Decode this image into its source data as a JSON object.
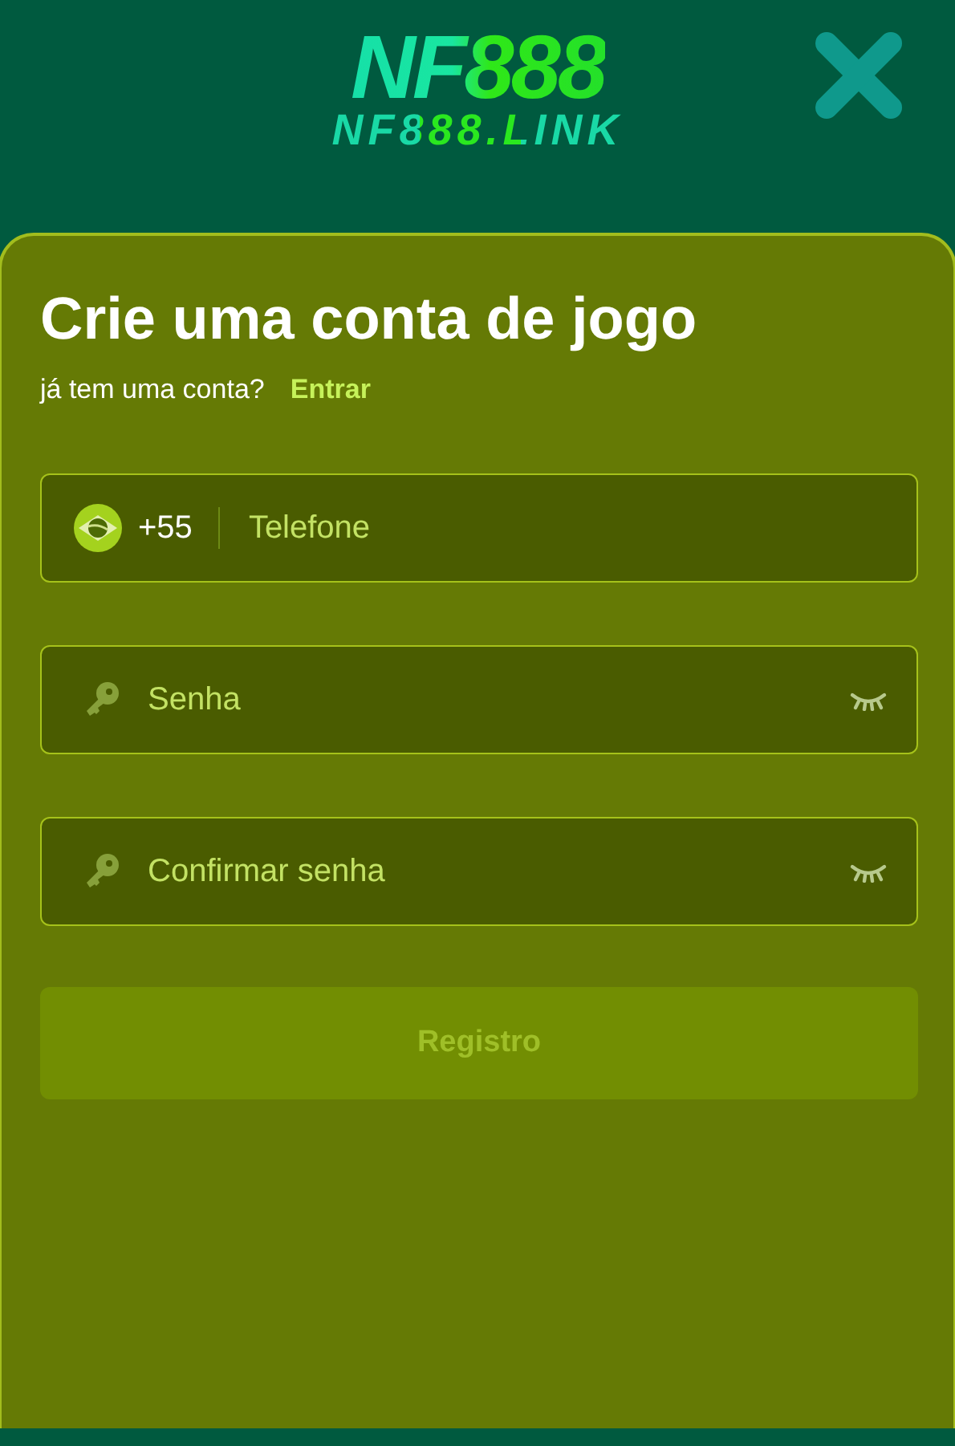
{
  "header": {
    "logo": "NF888",
    "tagline": "NF888.LINK"
  },
  "form": {
    "title": "Crie uma conta de jogo",
    "prompt": "já tem uma conta?",
    "login_link": "Entrar",
    "fields": [
      {
        "kind": "phone",
        "country_code": "+55",
        "placeholder": "Telefone"
      },
      {
        "kind": "password",
        "placeholder": "Senha"
      },
      {
        "kind": "password",
        "placeholder": "Confirmar senha"
      }
    ],
    "submit": {
      "label": "Registro",
      "disabled": true
    }
  }
}
